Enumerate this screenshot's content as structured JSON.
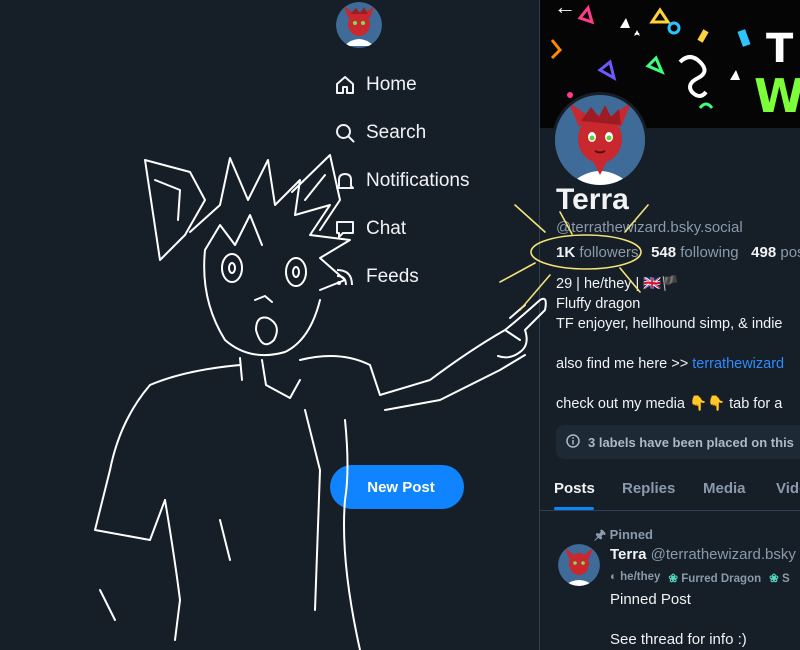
{
  "nav": {
    "items": [
      {
        "label": "Home",
        "icon": "home-icon"
      },
      {
        "label": "Search",
        "icon": "search-icon"
      },
      {
        "label": "Notifications",
        "icon": "bell-icon"
      },
      {
        "label": "Chat",
        "icon": "chat-icon"
      },
      {
        "label": "Feeds",
        "icon": "feeds-icon"
      }
    ],
    "new_post_label": "New Post"
  },
  "profile": {
    "display_name": "Terra",
    "handle": "@terrathewizard.bsky.social",
    "followers_count": "1K",
    "followers_label": "followers",
    "following_count": "548",
    "following_label": "following",
    "posts_count": "498",
    "posts_label": "posts",
    "bio_line1": "29 | he/they | 🇬🇧🏴",
    "bio_line2": "Fluffy dragon",
    "bio_line3": "TF enjoyer, hellhound simp, & indie",
    "bio_line4_prefix": "also find me here >> ",
    "bio_line4_link": "terrathewizard",
    "bio_line5": "check out my media 👇👇 tab for a",
    "labels_notice": "3 labels have been placed on this"
  },
  "tabs": [
    "Posts",
    "Replies",
    "Media",
    "Videos"
  ],
  "post": {
    "pinned_label": "Pinned",
    "author_name": "Terra",
    "author_handle": "@terrathewizard.bsky",
    "tags": [
      "he/they",
      "Furred Dragon",
      "S"
    ],
    "line1": "Pinned Post",
    "line2": "See thread for info :)"
  },
  "colors": {
    "background": "#161e27",
    "accent": "#1083fe",
    "muted": "#8a9aab",
    "link": "#2f8cff",
    "sketch": "#ffffff",
    "annotation": "#f2e27a"
  }
}
